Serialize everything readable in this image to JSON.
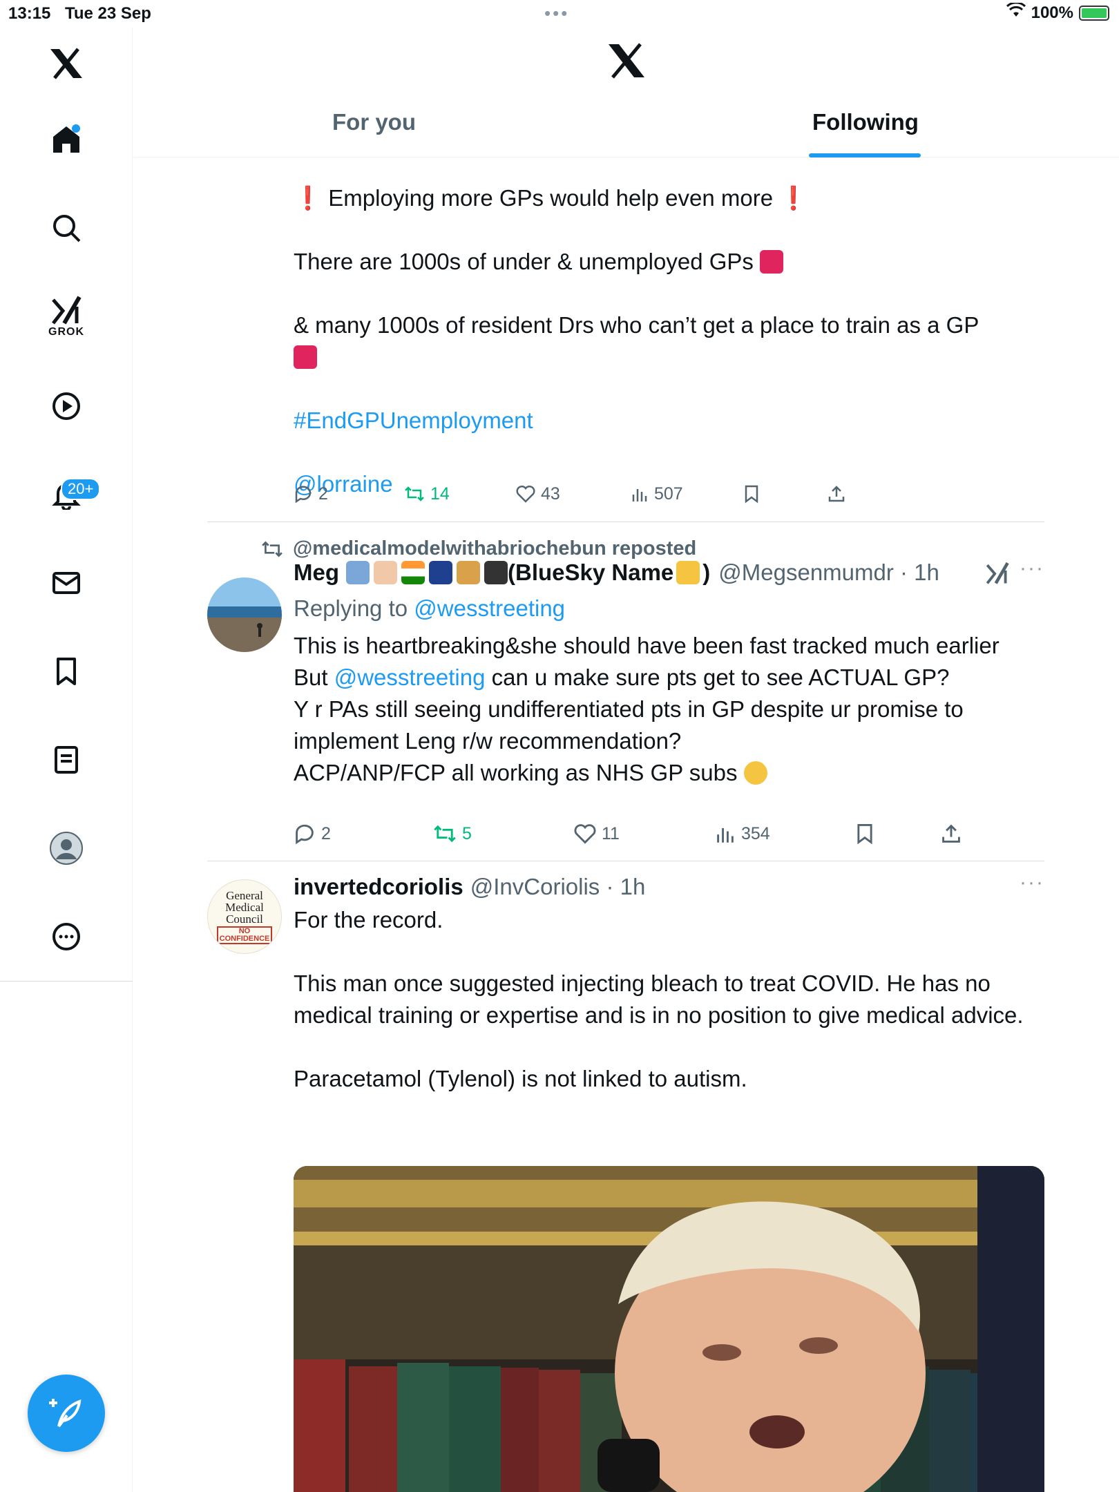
{
  "status_bar": {
    "time": "13:15",
    "date": "Tue 23 Sep",
    "battery": "100%"
  },
  "sidebar": {
    "grok_label": "GROK",
    "notifications_badge": "20+"
  },
  "header": {
    "tabs": [
      {
        "label": "For you",
        "active": false
      },
      {
        "label": "Following",
        "active": true
      }
    ]
  },
  "tweet1": {
    "lines": [
      "Employing more GPs would help even more",
      "There are 1000s of under & unemployed GPs",
      "& many 1000s of resident Drs who can’t get a place to train as a GP"
    ],
    "hashtag": "#EndGPUnemployment",
    "mention": "@lorraine",
    "replies": "2",
    "reposts": "14",
    "likes": "43",
    "views": "507"
  },
  "tweet2": {
    "repost_label": "@medicalmodelwithabriochebun reposted",
    "name_prefix": "Meg",
    "name_suffix": "(BlueSky Name",
    "name_close": ")",
    "handle": "@Megsenmumdr · 1h",
    "replying_to_label": "Replying to",
    "replying_to_handle": "@wesstreeting",
    "line1": "This is heartbreaking&she should have been fast tracked much earlier",
    "line2_pre": "But",
    "line2_mention": "@wesstreeting",
    "line2_post": "can u make sure pts get to see ACTUAL GP?",
    "line3": "Y r PAs still seeing undifferentiated pts in GP despite ur promise to",
    "line4": "implement Leng r/w recommendation?",
    "line5": "ACP/ANP/FCP all working as NHS GP subs",
    "replies": "2",
    "reposts": "5",
    "likes": "11",
    "views": "354"
  },
  "tweet3": {
    "avatar_text": [
      "General",
      "Medical",
      "Council"
    ],
    "avatar_stamp": [
      "NO",
      "CONFIDENCE"
    ],
    "name": "invertedcoriolis",
    "handle": "@InvCoriolis · 1h",
    "para1": "For the record.",
    "para2": "This man once suggested injecting bleach to treat COVID. He has no medical training or expertise and is in no position to give medical advice.",
    "para3": "Paracetamol (Tylenol) is not linked to autism."
  },
  "colors": {
    "accent": "#1d9bf0",
    "repost_green": "#00ba7c",
    "secondary_text": "#536471"
  }
}
